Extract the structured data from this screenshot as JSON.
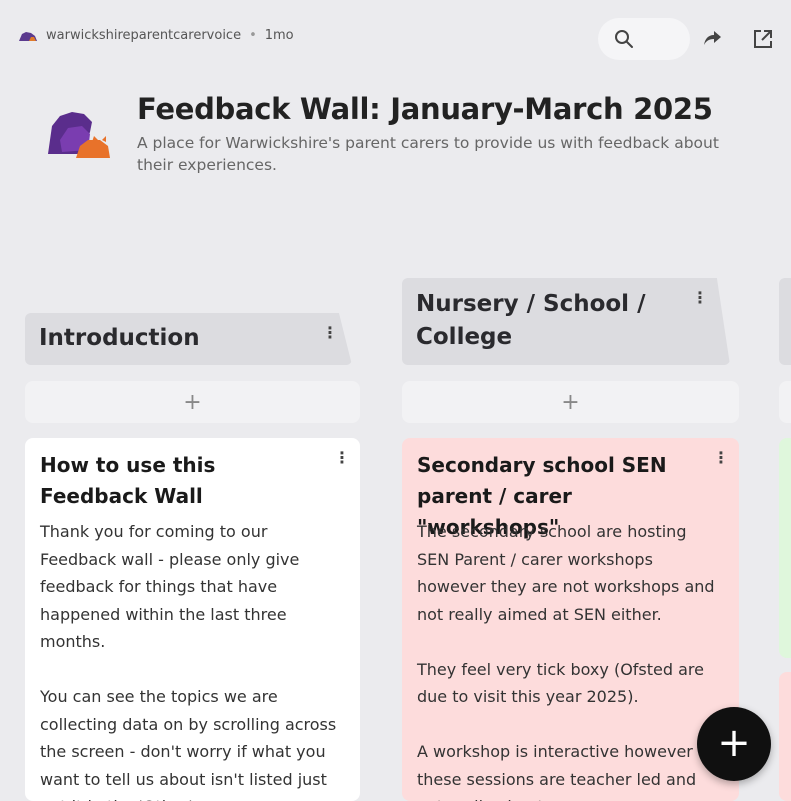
{
  "topbar": {
    "author": "warwickshireparentcarervoice",
    "separator": "•",
    "time": "1mo"
  },
  "icons": {
    "author": "bear-logo-icon",
    "search": "search-icon",
    "share": "share-arrow-icon",
    "open": "open-external-icon",
    "header_logo": "bear-logo-icon",
    "add": "plus-icon",
    "menu": "kebab-menu-icon"
  },
  "header": {
    "title": "Feedback Wall: January-March 2025",
    "subtitle": "A place for Warwickshire's parent carers to provide us with feedback about their experiences."
  },
  "columns": [
    {
      "title": "Introduction",
      "add_label": "+",
      "menu": "⋮",
      "card": {
        "title": "How to use this Feedback Wall",
        "body": "Thank you for coming to our Feedback wall - please only give feedback for things that have happened within the last three months.\n\nYou can see the topics we are collecting data on by scrolling across the screen - don't worry if what you want to tell us about isn't listed just put it in the 'Other'",
        "color": "#ffffff",
        "menu": "⋮"
      }
    },
    {
      "title": "Nursery / School / College",
      "add_label": "+",
      "menu": "⋮",
      "card": {
        "title": "Secondary school SEN parent / carer \"workshops\"",
        "body": "The secondary  school are hosting SEN Parent / carer workshops however  they are not workshops and not really aimed at SEN either.\n\nThey feel very tick boxy (Ofsted are due to visit this year 2025).\n\nA workshop is interactive  however these sessions  are teacher  led and not really about",
        "color": "#fddcdc",
        "menu": "⋮"
      }
    }
  ],
  "fab": {
    "label": "+"
  },
  "colors": {
    "background": "#ebebee",
    "column_header": "#dcdce0",
    "card_pink": "#fddcdc",
    "card_green_peek": "#dff7dc",
    "fab": "#101010"
  }
}
